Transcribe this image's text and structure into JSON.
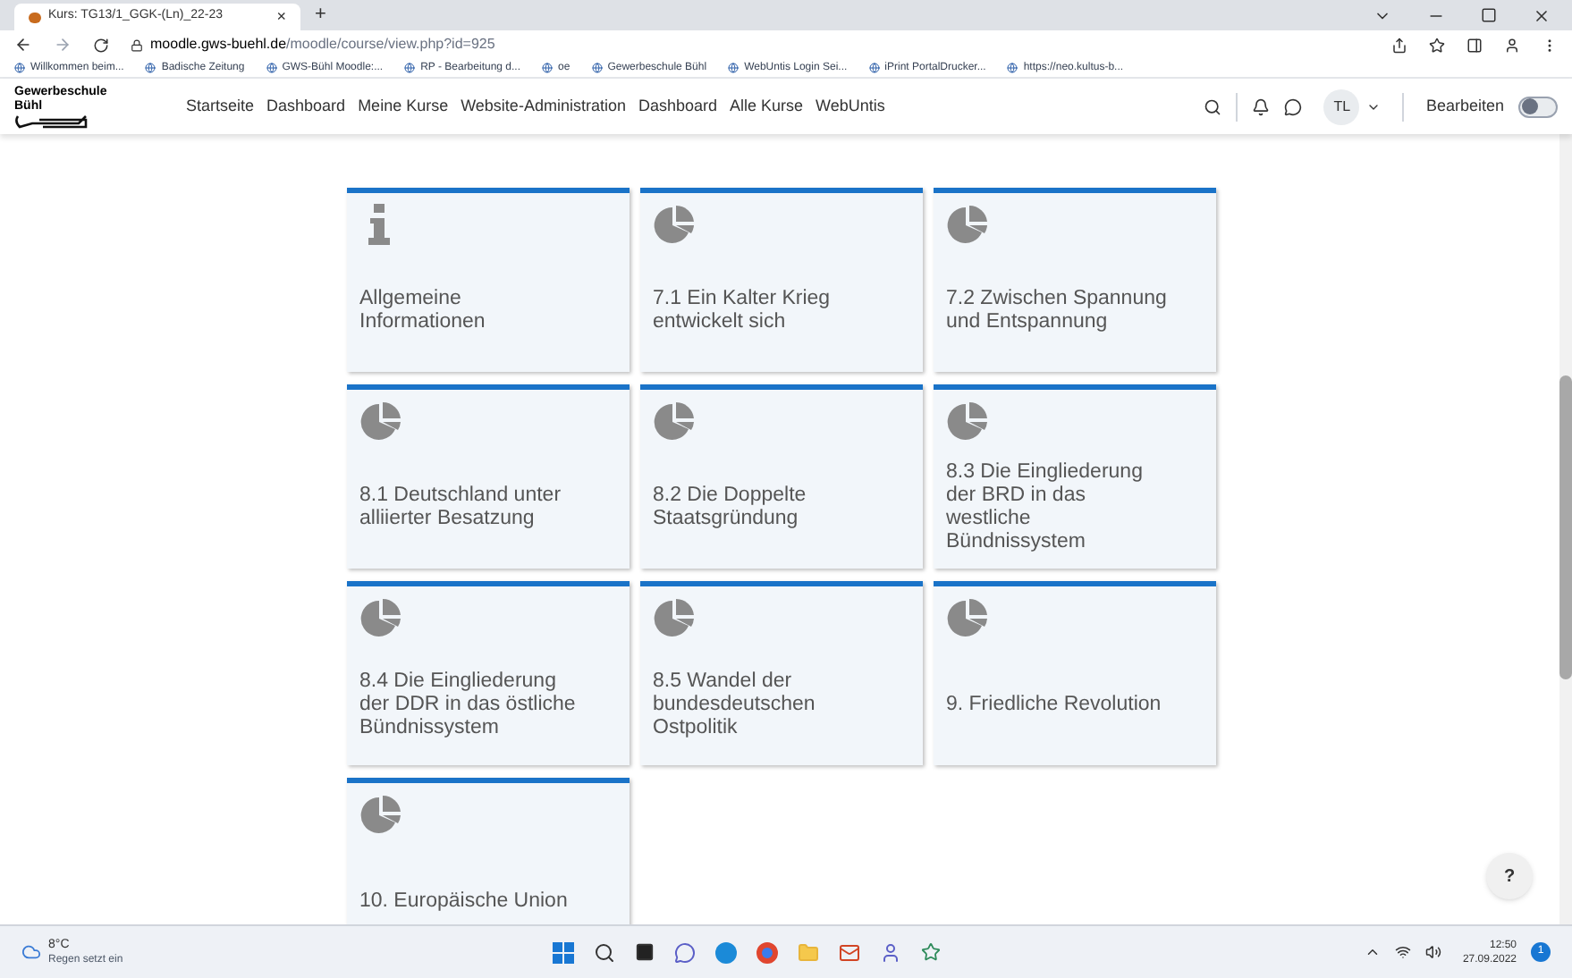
{
  "browser": {
    "tab_title": "Kurs: TG13/1_GGK-(Ln)_22-23",
    "tab_close": "×",
    "new_tab": "+",
    "address_domain": "moodle.gws-buehl.de",
    "address_path": "/moodle/course/view.php?id=925"
  },
  "bookmarks": [
    "Willkommen beim...",
    "Badische Zeitung",
    "GWS-Bühl Moodle:...",
    "RP - Bearbeitung d...",
    "oe",
    "Gewerbeschule Bühl",
    "WebUntis Login Sei...",
    "iPrint PortalDrucker...",
    "https://neo.kultus-b..."
  ],
  "site": {
    "logo_line1": "Gewerbeschule",
    "logo_line2": "Bühl",
    "nav": [
      "Startseite",
      "Dashboard",
      "Meine Kurse",
      "Website-Administration",
      "Dashboard",
      "Alle Kurse",
      "WebUntis"
    ],
    "user_initials": "TL",
    "edit_label": "Bearbeiten",
    "edit_on": false
  },
  "tiles": [
    {
      "kind": "info",
      "title": "Allgemeine Informationen"
    },
    {
      "kind": "topic",
      "title": "7.1 Ein Kalter Krieg entwickelt sich"
    },
    {
      "kind": "topic",
      "title": "7.2 Zwischen Spannung und Entspannung"
    },
    {
      "kind": "topic",
      "title": "8.1 Deutschland unter alliierter Besatzung"
    },
    {
      "kind": "topic",
      "title": "8.2 Die Doppelte Staatsgründung"
    },
    {
      "kind": "topic",
      "title": "8.3 Die Eingliederung der BRD in das westliche Bündnissystem"
    },
    {
      "kind": "topic",
      "title": "8.4 Die Eingliederung der DDR in das östliche Bündnissystem"
    },
    {
      "kind": "topic",
      "title": "8.5 Wandel der bundesdeutschen Ostpolitik"
    },
    {
      "kind": "topic",
      "title": "9. Friedliche Revolution"
    },
    {
      "kind": "topic",
      "title": "10. Europäische Union"
    }
  ],
  "help": "?",
  "taskbar": {
    "temperature": "8°C",
    "weather": "Regen setzt ein",
    "time": "12:50",
    "date": "27.09.2022",
    "notifications": "1"
  }
}
